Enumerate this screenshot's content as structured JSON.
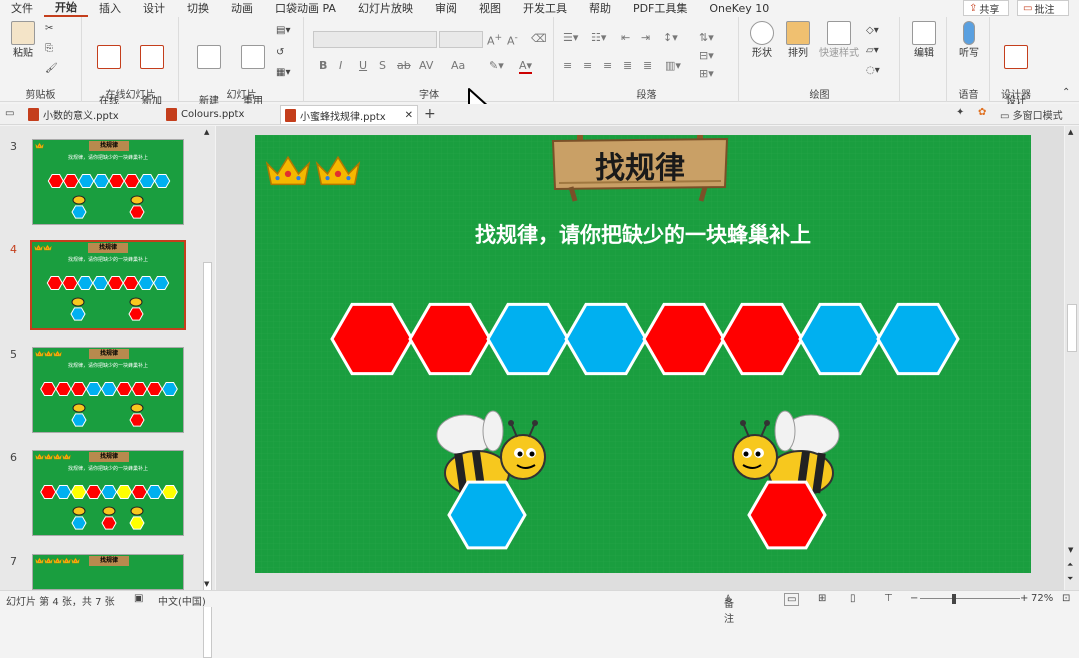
{
  "menu": {
    "items": [
      "文件",
      "开始",
      "插入",
      "设计",
      "切换",
      "动画",
      "口袋动画 PA",
      "幻灯片放映",
      "审阅",
      "视图",
      "开发工具",
      "帮助",
      "PDF工具集",
      "OneKey 10"
    ],
    "active_index": 1,
    "share": "共享",
    "comment": "批注"
  },
  "ribbon": {
    "clipboard": {
      "paste": "粘贴",
      "group": "剪贴板"
    },
    "online_slides": {
      "online": "在线\n幻灯片",
      "new_anim": "新加\n动画页",
      "group": "在线幻灯片"
    },
    "slides": {
      "new_slide": "新建\n幻灯片",
      "reuse": "重用\n幻灯片",
      "group": "幻灯片"
    },
    "font": {
      "group": "字体",
      "bold": "B",
      "italic": "I",
      "underline": "U",
      "shadow": "S",
      "strike": "ab",
      "spacing": "AV",
      "case": "Aa"
    },
    "paragraph": {
      "group": "段落"
    },
    "drawing": {
      "shape": "形状",
      "arrange": "排列",
      "quick_style": "快速样式",
      "group": "绘图"
    },
    "editing": {
      "label": "编辑"
    },
    "voice": {
      "dictate": "听写",
      "group": "语音"
    },
    "designer": {
      "label": "设计\n灵感",
      "group": "设计器"
    }
  },
  "tabs": [
    {
      "label": "小数的意义.pptx",
      "active": false
    },
    {
      "label": "Colours.pptx",
      "active": false
    },
    {
      "label": "小蜜蜂找规律.pptx",
      "active": true
    }
  ],
  "tabs_right": {
    "multi_window": "多窗口模式"
  },
  "thumbnails": [
    {
      "num": "3",
      "title": "找规律",
      "sub": "找规律，请你把缺少的一块蜂巢补上",
      "crowns": 1,
      "selected": false
    },
    {
      "num": "4",
      "title": "找规律",
      "sub": "找规律，请你把缺少的一块蜂巢补上",
      "crowns": 2,
      "selected": true
    },
    {
      "num": "5",
      "title": "找规律",
      "sub": "找规律，请你把缺少的一块蜂巢补上",
      "crowns": 3,
      "selected": false
    },
    {
      "num": "6",
      "title": "找规律",
      "sub": "找规律，请你把缺少的一块蜂巢补上",
      "crowns": 4,
      "selected": false
    },
    {
      "num": "7",
      "title": "找规律",
      "sub": "",
      "crowns": 5,
      "selected": false
    }
  ],
  "slide": {
    "title": "找规律",
    "instruction": "找规律，请你把缺少的一块蜂巢补上",
    "crowns": 2,
    "hex_row": [
      "red",
      "red",
      "blue",
      "blue",
      "red",
      "red",
      "blue",
      "blue"
    ],
    "bee_left_hex": "blue",
    "bee_right_hex": "red"
  },
  "colors": {
    "red": "#ff0000",
    "blue": "#00b0f0",
    "yellow": "#ffff00",
    "green": "#1a9e3f",
    "accent": "#c43e1c"
  },
  "status": {
    "slide_info": "幻灯片 第 4 张，共 7 张",
    "language": "中文(中国)",
    "notes": "备注",
    "zoom": "72%"
  }
}
